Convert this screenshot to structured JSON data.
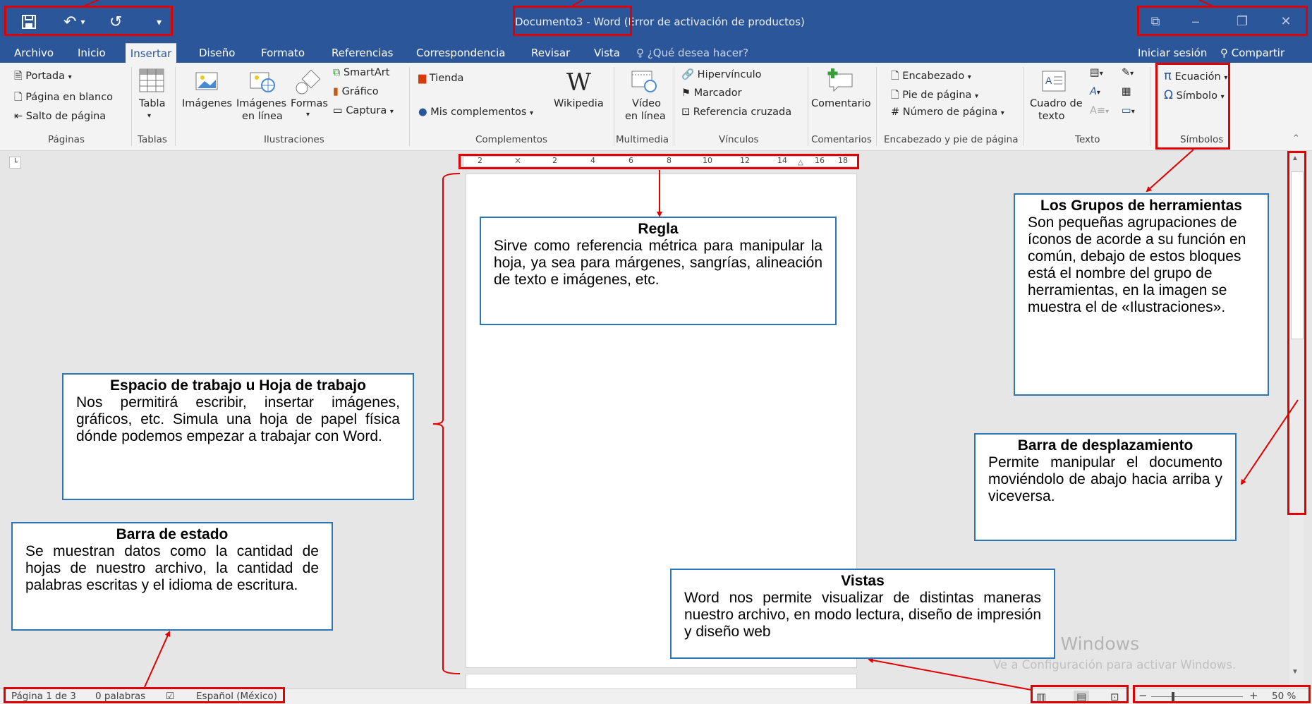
{
  "qat": {
    "save_icon": "save-icon",
    "undo_icon": "undo-icon",
    "redo_icon": "redo-icon",
    "customize_icon": "customize-qat-icon"
  },
  "window": {
    "title": "Documento3 - Word (Error de activación de productos)"
  },
  "tabs": [
    {
      "label": "Archivo"
    },
    {
      "label": "Inicio"
    },
    {
      "label": "Insertar"
    },
    {
      "label": "Diseño"
    },
    {
      "label": "Formato"
    },
    {
      "label": "Referencias"
    },
    {
      "label": "Correspondencia"
    },
    {
      "label": "Revisar"
    },
    {
      "label": "Vista"
    },
    {
      "label": "¿Qué desea hacer?"
    }
  ],
  "account": {
    "signin": "Iniciar sesión",
    "share": "Compartir"
  },
  "ribbon": {
    "paginas": {
      "portada": "Portada",
      "pagina_blanco": "Página en blanco",
      "salto": "Salto de página",
      "label": "Páginas"
    },
    "tablas": {
      "tabla": "Tabla",
      "label": "Tablas"
    },
    "ilustraciones": {
      "imagenes": "Imágenes",
      "imagenes_linea_1": "Imágenes",
      "imagenes_linea_2": "en línea",
      "formas": "Formas",
      "smartart": "SmartArt",
      "grafico": "Gráfico",
      "captura": "Captura",
      "label": "Ilustraciones"
    },
    "complementos": {
      "tienda": "Tienda",
      "mis": "Mis complementos",
      "wikipedia": "Wikipedia",
      "label": "Complementos"
    },
    "multimedia": {
      "video_1": "Vídeo",
      "video_2": "en línea",
      "label": "Multimedia"
    },
    "vinculos": {
      "hipervinculo": "Hipervínculo",
      "marcador": "Marcador",
      "referencia": "Referencia cruzada",
      "label": "Vínculos"
    },
    "comentarios": {
      "comentario": "Comentario",
      "label": "Comentarios"
    },
    "encabezado": {
      "encabezado": "Encabezado",
      "pie": "Pie de página",
      "numero": "Número de página",
      "label": "Encabezado y pie de página"
    },
    "texto": {
      "cuadro_1": "Cuadro de",
      "cuadro_2": "texto",
      "label": "Texto"
    },
    "simbolos": {
      "ecuacion": "Ecuación",
      "simbolo": "Símbolo",
      "label": "Símbolos"
    }
  },
  "ruler": {
    "ticks": [
      "2",
      "2",
      "4",
      "6",
      "8",
      "10",
      "12",
      "14",
      "16",
      "18"
    ]
  },
  "status": {
    "page": "Página 1 de 3",
    "words": "0 palabras",
    "language": "Español (México)",
    "zoom": "50 %"
  },
  "watermark": {
    "line1": "Activar Windows",
    "line2": "Ve a Configuración para activar Windows."
  },
  "annotations": {
    "regla": {
      "title": "Regla",
      "body": "Sirve como referencia métrica para manipular la hoja, ya sea para márgenes, sangrías, alineación de texto e imágenes, etc."
    },
    "grupos": {
      "title": "Los Grupos de herramientas",
      "body": "Son pequeñas agrupaciones de íconos de acorde a su función en común, debajo de estos bloques está el nombre del grupo de herramientas, en la imagen se muestra el de «Ilustraciones»."
    },
    "espacio": {
      "title": "Espacio de trabajo u Hoja de trabajo",
      "body": "Nos permitirá escribir, insertar imágenes, gráficos, etc. Simula una hoja de papel física dónde podemos empezar a trabajar con Word."
    },
    "desplazamiento": {
      "title": "Barra de desplazamiento",
      "body": "Permite manipular el documento moviéndolo de abajo hacia arriba y viceversa."
    },
    "estado": {
      "title": "Barra de estado",
      "body": "Se muestran datos como la cantidad de hojas de nuestro archivo, la cantidad de palabras escritas y el idioma de escritura."
    },
    "vistas": {
      "title": "Vistas",
      "body": "Word nos permite visualizar de distintas maneras nuestro archivo, en modo lectura, diseño de impresión y diseño web"
    }
  },
  "colors": {
    "brand": "#2b579a",
    "annotation_border": "#2e75b6",
    "highlight": "#e00000"
  }
}
